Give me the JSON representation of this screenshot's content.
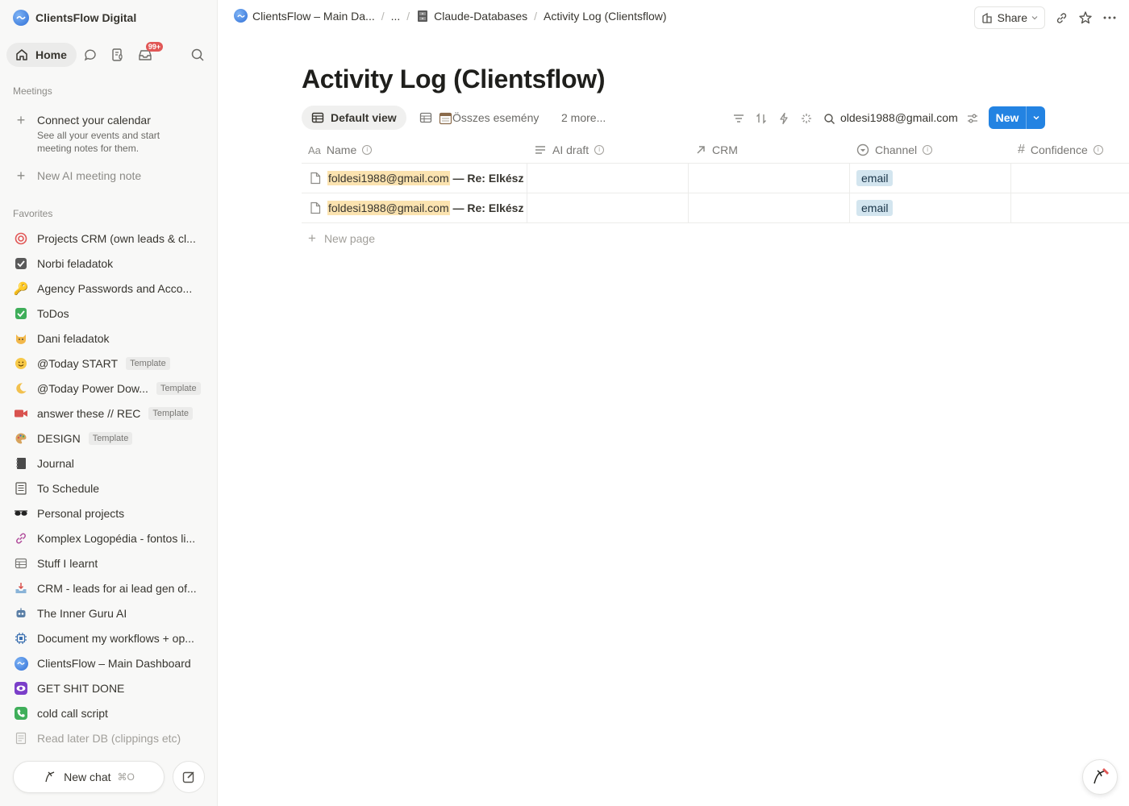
{
  "sidebar": {
    "workspace_name": "ClientsFlow Digital",
    "home_label": "Home",
    "inbox_badge": "99+",
    "meetings_title": "Meetings",
    "connect_calendar": "Connect your calendar",
    "connect_calendar_sub": "See all your events and start meeting notes for them.",
    "new_ai_note": "New AI meeting note",
    "favorites_title": "Favorites",
    "favorites": [
      {
        "label": "Projects CRM (own leads & cl...",
        "icon": "target-icon"
      },
      {
        "label": "Norbi feladatok",
        "icon": "checkbox-icon"
      },
      {
        "label": "Agency Passwords and Acco...",
        "icon": "key-icon"
      },
      {
        "label": "ToDos",
        "icon": "green-check-icon"
      },
      {
        "label": "Dani feladatok",
        "icon": "cat-icon"
      },
      {
        "label": "@Today START",
        "icon": "smile-icon",
        "tag": "Template"
      },
      {
        "label": "@Today Power Dow...",
        "icon": "moon-icon",
        "tag": "Template"
      },
      {
        "label": "answer these // REC",
        "icon": "video-icon",
        "tag": "Template"
      },
      {
        "label": "DESIGN",
        "icon": "palette-icon",
        "tag": "Template"
      },
      {
        "label": "Journal",
        "icon": "notebook-icon"
      },
      {
        "label": "To Schedule",
        "icon": "list-icon"
      },
      {
        "label": "Personal projects",
        "icon": "sunglasses-icon"
      },
      {
        "label": "Komplex Logopédia - fontos li...",
        "icon": "link-icon"
      },
      {
        "label": "Stuff I learnt",
        "icon": "table-icon"
      },
      {
        "label": "CRM - leads for ai lead gen of...",
        "icon": "inbox-tray-icon"
      },
      {
        "label": "The Inner Guru AI",
        "icon": "robot-icon"
      },
      {
        "label": "Document my workflows + op...",
        "icon": "chip-icon"
      },
      {
        "label": "ClientsFlow – Main Dashboard",
        "icon": "clientsflow-logo-icon"
      },
      {
        "label": "GET SHIT DONE",
        "icon": "purple-eye-icon"
      },
      {
        "label": "cold call script",
        "icon": "phone-icon"
      },
      {
        "label": "Read later DB (clippings etc)",
        "icon": "doc-list-icon",
        "faded": true
      }
    ],
    "new_chat": "New chat",
    "new_chat_kbd": "⌘O"
  },
  "topbar": {
    "crumbs": [
      "ClientsFlow – Main Da...",
      "...",
      "Claude-Databases",
      "Activity Log (Clientsflow)"
    ],
    "share_label": "Share"
  },
  "page": {
    "title": "Activity Log (Clientsflow)",
    "views": [
      "Default view",
      "Összes esemény",
      "2 more..."
    ],
    "search_value": "oldesi1988@gmail.com",
    "new_label": "New",
    "columns": [
      "Name",
      "AI draft",
      "CRM",
      "Channel",
      "Confidence"
    ],
    "rows": [
      {
        "email": "foldesi1988@gmail.com",
        "rest": " — Re: Elkész",
        "channel": "email"
      },
      {
        "email": "foldesi1988@gmail.com",
        "rest": " — Re: Elkész",
        "channel": "email"
      }
    ],
    "new_page": "New page"
  },
  "colors": {
    "accent": "#2383e2",
    "badge": "#e15756",
    "highlight": "#fbe3b0",
    "tag_bg": "#d3e5ef"
  }
}
